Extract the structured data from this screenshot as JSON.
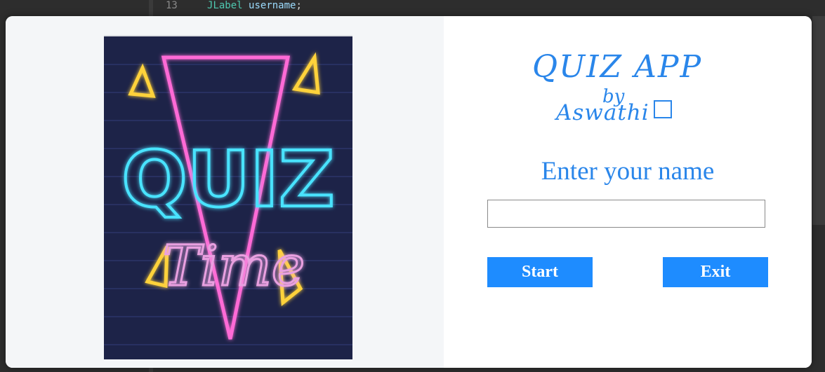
{
  "editor": {
    "top_line": {
      "number": "13",
      "type": "JLabel",
      "name": "username",
      "end": ";"
    }
  },
  "dialog": {
    "poster": {
      "image_name": "neon-quiz-time-poster",
      "alt": "QUIZ Time",
      "text_quiz": "QUIZ",
      "text_time": "Time",
      "colors": {
        "background": "#1d2348",
        "cyan": "#48e3ff",
        "pink": "#ff6bd6",
        "yellow": "#ffd23a",
        "violet": "#e9a0e0"
      }
    },
    "title": "QUIZ APP",
    "subtitle": "by",
    "author": "Aswathi",
    "author_icon": "box-glyph",
    "prompt": "Enter your name",
    "name_input": {
      "value": "",
      "placeholder": ""
    },
    "buttons": {
      "start": "Start",
      "exit": "Exit"
    },
    "colors": {
      "accent": "#2a86ea",
      "button": "#1e8cff"
    }
  }
}
